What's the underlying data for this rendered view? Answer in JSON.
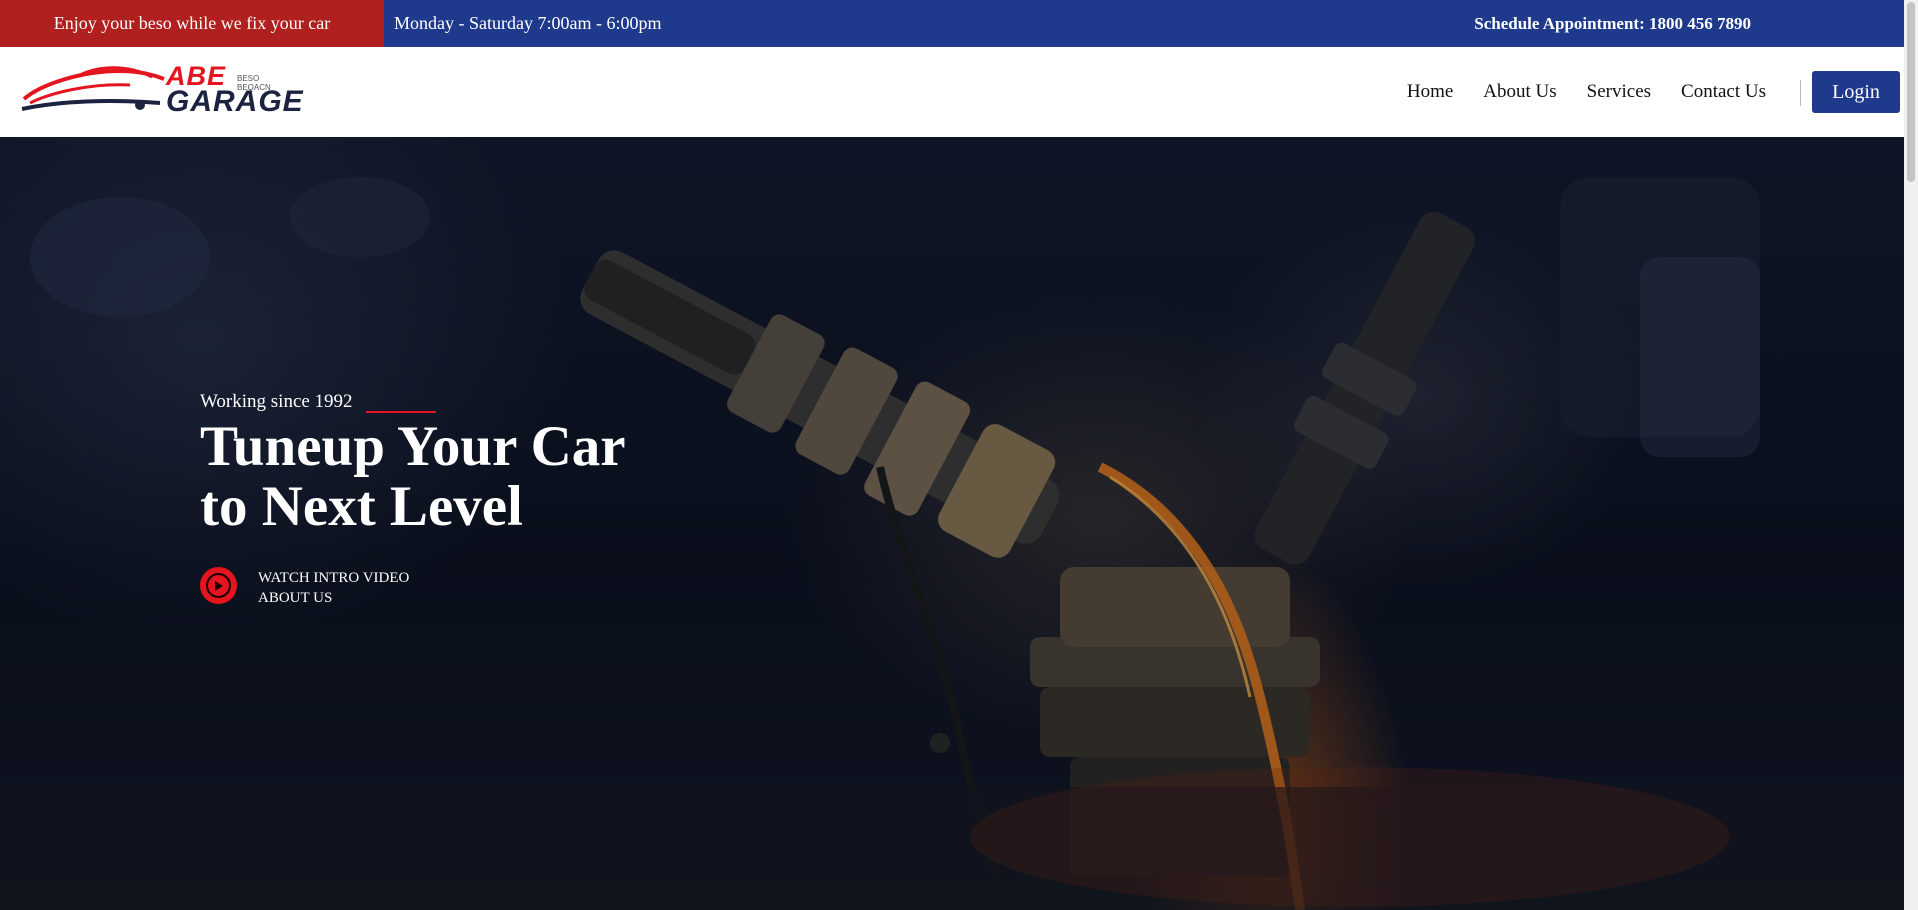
{
  "topbar": {
    "promo": "Enjoy your beso while we fix your car",
    "hours": "Monday - Saturday 7:00am - 6:00pm",
    "appointment_label": "Schedule Appointment:",
    "appointment_phone": "1800 456 7890"
  },
  "brand": {
    "line1": "ABE",
    "line2": "GARAGE",
    "tagline": "BESO BEQACN"
  },
  "nav": {
    "items": [
      "Home",
      "About Us",
      "Services",
      "Contact Us"
    ],
    "login": "Login"
  },
  "hero": {
    "kicker": "Working since 1992",
    "headline_line1": "Tuneup Your Car",
    "headline_line2": "to Next Level",
    "video_line1": "WATCH INTRO VIDEO",
    "video_line2": "ABOUT US"
  },
  "colors": {
    "brand_red": "#e4151f",
    "brand_blue": "#1f3a8c",
    "promo_red": "#b0201f"
  },
  "icons": {
    "video": "play-circle-icon",
    "logo": "car-silhouette-icon"
  }
}
